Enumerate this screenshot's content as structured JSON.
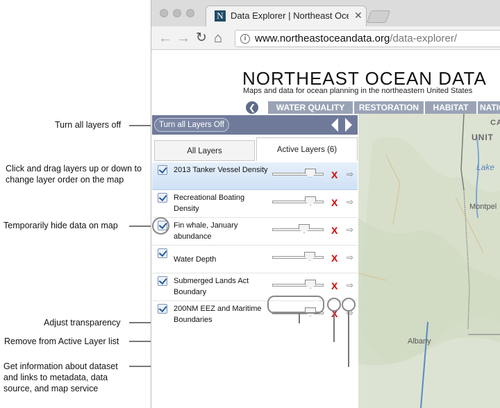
{
  "annotations": {
    "turn_all_off": "Turn all layers off",
    "drag_reorder": "Click and drag layers up or down to change layer order on the map",
    "hide_data": "Temporarily hide data on map",
    "adjust_transparency": "Adjust transparency",
    "remove_layer": "Remove from Active Layer list",
    "get_info": "Get information about dataset and links to metadata, data source, and map service"
  },
  "browser": {
    "tab_title": "Data Explorer | Northeast Ocean",
    "tab_favicon": "N",
    "tab_close": "✕",
    "url_host": "www.northeastoceandata.org",
    "url_path": "/data-explorer/"
  },
  "site": {
    "title": "NORTHEAST OCEAN DATA",
    "subtitle": "Maps and data for ocean planning in the northeastern United States",
    "topics": [
      "WATER QUALITY",
      "RESTORATION",
      "HABITAT",
      "NATIO"
    ]
  },
  "panel": {
    "turn_off_label": "Turn all Layers Off",
    "tabs": [
      "All Layers",
      "Active Layers (6)"
    ],
    "layers": [
      {
        "name": "2013 Tanker Vessel Density",
        "checked": true
      },
      {
        "name": "Recreational Boating Density",
        "checked": true
      },
      {
        "name": "Fin whale, January abundance",
        "checked": true
      },
      {
        "name": "Water Depth",
        "checked": true
      },
      {
        "name": "Submerged Lands Act Boundary",
        "checked": true
      },
      {
        "name": "200NM EEZ and Maritime Boundaries",
        "checked": true
      }
    ],
    "remove_glyph": "X",
    "info_glyph": "⇨"
  },
  "map": {
    "labels": [
      "CA",
      "UNIT",
      "Lake",
      "Montpel",
      "Albany"
    ]
  },
  "colors": {
    "panel_toolbar": "#6f7a9a",
    "topic_bar": "#9aa3b6",
    "remove_red": "#d90000",
    "selected_row": "#d7e6f7"
  }
}
